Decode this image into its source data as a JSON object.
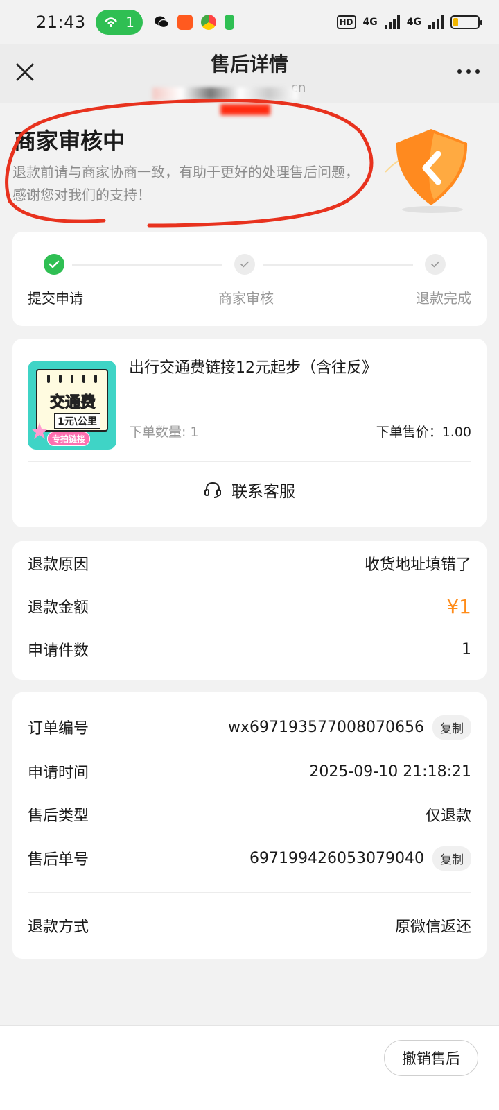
{
  "status_bar": {
    "time": "21:43",
    "hotspot_count": "1",
    "hd_label": "HD",
    "network_1": "4G",
    "network_2": "4G",
    "battery_percent": 20
  },
  "nav": {
    "title": "售后详情",
    "subtitle": "cn"
  },
  "status": {
    "title": "商家审核中",
    "description": "退款前请与商家协商一致，有助于更好的处理售后问题，感谢您对我们的支持！"
  },
  "steps": [
    {
      "label": "提交申请",
      "done": true
    },
    {
      "label": "商家审核",
      "done": false
    },
    {
      "label": "退款完成",
      "done": false
    }
  ],
  "product": {
    "name": "出行交通费链接12元起步（含往反》",
    "quantity": "下单数量: 1",
    "price": "下单售价：1.00",
    "thumb_text_1": "交通费",
    "thumb_text_2": "1元\\公里",
    "thumb_text_3": "专拍链接",
    "service_label": "联系客服"
  },
  "refund": {
    "reason_label": "退款原因",
    "reason_value": "收货地址填错了",
    "amount_label": "退款金额",
    "amount_value": "¥1",
    "count_label": "申请件数",
    "count_value": "1"
  },
  "order": {
    "order_no_label": "订单编号",
    "order_no_value": "wx697193577008070656",
    "copy_label": "复制",
    "apply_time_label": "申请时间",
    "apply_time_value": "2025-09-10 21:18:21",
    "type_label": "售后类型",
    "type_value": "仅退款",
    "after_no_label": "售后单号",
    "after_no_value": "697199426053079040",
    "method_label": "退款方式",
    "method_value": "原微信返还"
  },
  "bottom": {
    "cancel_label": "撤销售后"
  },
  "colors": {
    "success": "#2fbf53",
    "amount": "#ff8c1a",
    "annotation": "#e8321e"
  }
}
